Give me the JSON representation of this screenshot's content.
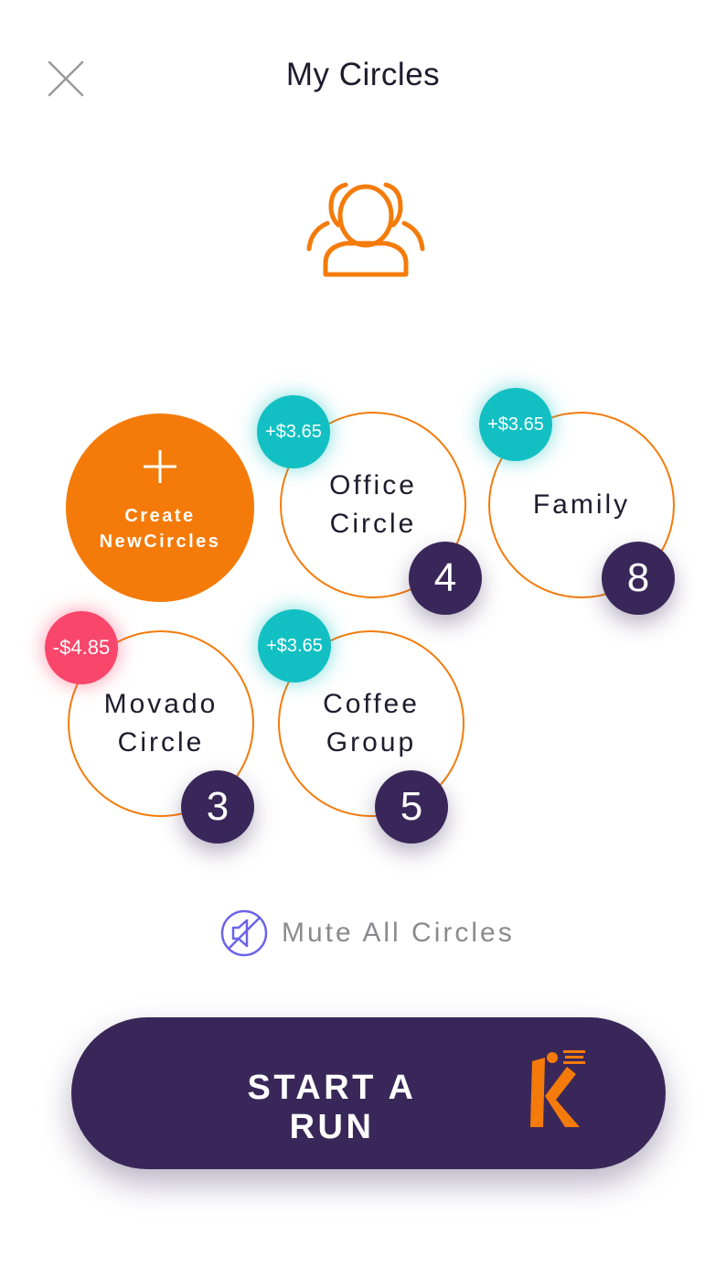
{
  "header": {
    "title": "My Circles"
  },
  "create_circle": {
    "label": "Create\nNewCircles"
  },
  "circles": [
    {
      "name": "Office\nCircle",
      "members": "4",
      "balance": "+$3.65",
      "balance_type": "positive"
    },
    {
      "name": "Family",
      "members": "8",
      "balance": "+$3.65",
      "balance_type": "positive"
    },
    {
      "name": "Movado\nCircle",
      "members": "3",
      "balance": "-$4.85",
      "balance_type": "negative"
    },
    {
      "name": "Coffee\nGroup",
      "members": "5",
      "balance": "+$3.65",
      "balance_type": "positive"
    }
  ],
  "mute": {
    "label": "Mute All Circles"
  },
  "cta": {
    "label": "START A RUN"
  },
  "icons": {
    "close": "close-icon",
    "hero": "group-users-icon",
    "plus": "plus-icon",
    "mute": "speaker-muted-icon",
    "logo": "k-run-logo-icon"
  },
  "colors": {
    "accent_orange": "#f47b0a",
    "primary_purple": "#3a2759",
    "positive_teal": "#12c0c3",
    "negative_pink": "#f9466b",
    "mute_icon_blue": "#6b63e8"
  }
}
